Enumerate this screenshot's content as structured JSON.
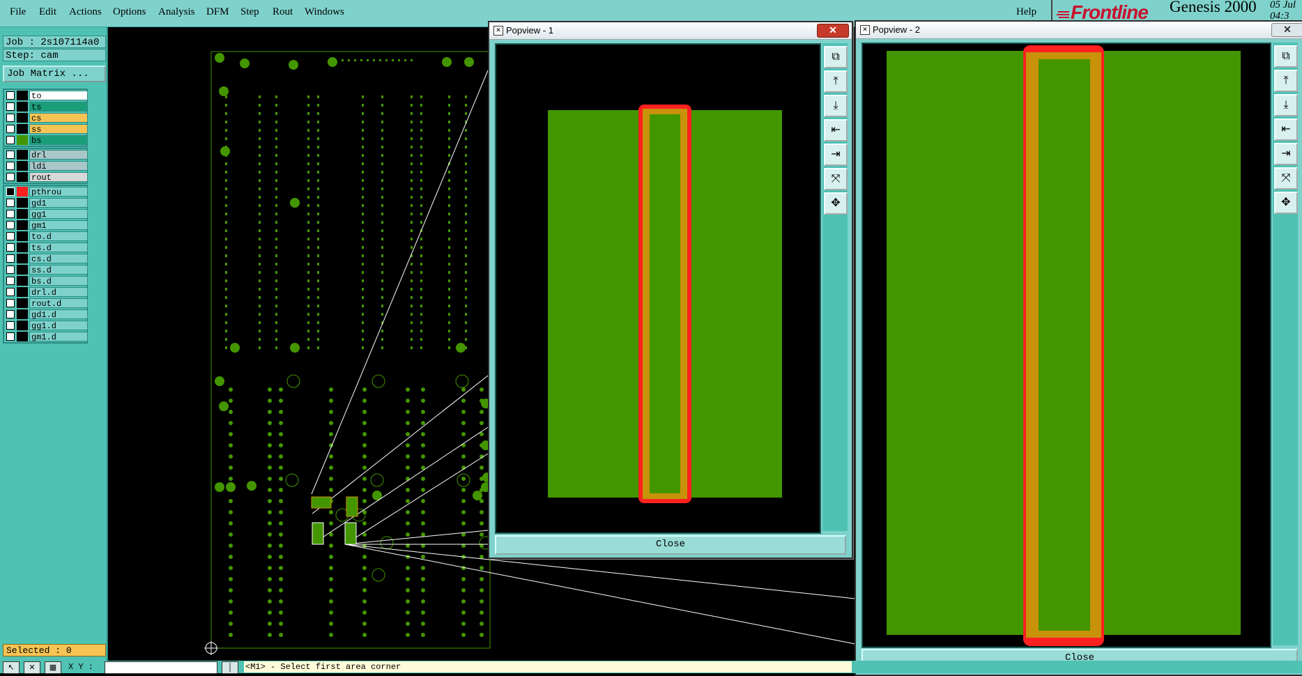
{
  "menu": {
    "items": [
      {
        "label": "File"
      },
      {
        "label": "Edit"
      },
      {
        "label": "Actions"
      },
      {
        "label": "Options"
      },
      {
        "label": "Analysis"
      },
      {
        "label": "DFM"
      },
      {
        "label": "Step"
      },
      {
        "label": "Rout"
      },
      {
        "label": "Windows"
      }
    ],
    "help": "Help"
  },
  "brand": {
    "logo": "Frontline",
    "product": "Genesis 2000",
    "date_line1": "05 Jul",
    "date_line2": "04:3"
  },
  "job": {
    "job_label": "Job : 2s107114a0",
    "step_label": "Step: cam",
    "matrix_button": "Job Matrix ..."
  },
  "layers": {
    "group1": [
      {
        "name": "to",
        "color": "#ffffff"
      },
      {
        "name": "ts",
        "color": "#1a9e7a"
      },
      {
        "name": "cs",
        "color": "#f5c454"
      },
      {
        "name": "ss",
        "color": "#f5c454"
      },
      {
        "name": "bs",
        "color": "#1a9e7a"
      }
    ],
    "group2": [
      {
        "name": "drl",
        "color": "#a9c7c8"
      },
      {
        "name": "ldi",
        "color": "#a9c7c8"
      },
      {
        "name": "rout",
        "color": "#d8d8d8"
      }
    ],
    "group3": [
      {
        "name": "pthrou",
        "color": "#7fd2cc"
      },
      {
        "name": "gd1",
        "color": "#7fd2cc"
      },
      {
        "name": "gg1",
        "color": "#7fd2cc"
      },
      {
        "name": "gm1",
        "color": "#7fd2cc"
      },
      {
        "name": "to.d",
        "color": "#7fd2cc"
      },
      {
        "name": "ts.d",
        "color": "#7fd2cc"
      },
      {
        "name": "cs.d",
        "color": "#7fd2cc"
      },
      {
        "name": "ss.d",
        "color": "#7fd2cc"
      },
      {
        "name": "bs.d",
        "color": "#7fd2cc"
      },
      {
        "name": "drl.d",
        "color": "#7fd2cc"
      },
      {
        "name": "rout.d",
        "color": "#7fd2cc"
      },
      {
        "name": "gd1.d",
        "color": "#7fd2cc"
      },
      {
        "name": "gg1.d",
        "color": "#7fd2cc"
      },
      {
        "name": "gm1.d",
        "color": "#7fd2cc"
      }
    ]
  },
  "selected": "Selected : 0",
  "status": {
    "xy_label": "X Y :",
    "message": "<M1> - Select first area corner"
  },
  "popview1": {
    "title": "Popview - 1",
    "close_label": "Close"
  },
  "popview2": {
    "title": "Popview - 2",
    "close_label": "Close"
  },
  "colors": {
    "pad_green": "#449600",
    "trace_orange": "#c8920a",
    "highlight_red": "#ff2020",
    "panel_teal": "#4fc2b4",
    "menu_teal": "#7fd2cc"
  }
}
